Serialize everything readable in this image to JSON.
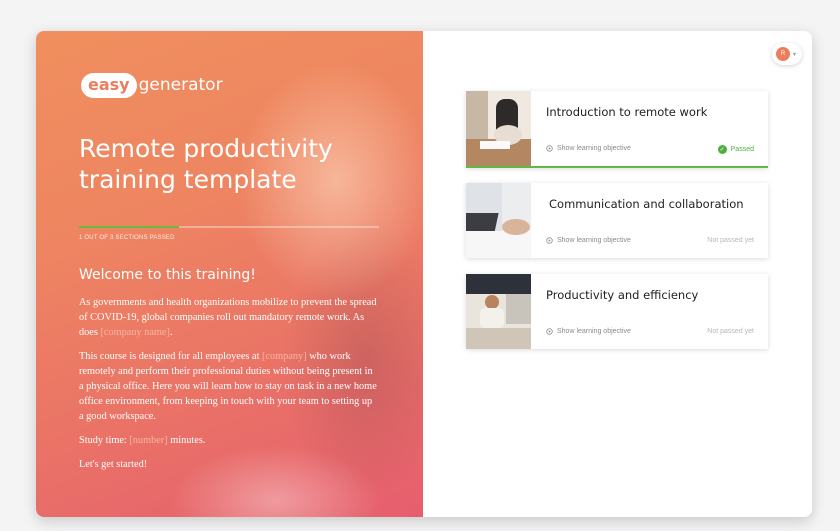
{
  "brand": {
    "logo_highlight": "easy",
    "logo_rest": "generator"
  },
  "course": {
    "title": "Remote productivity training template",
    "progress_label": "1 OUT OF 3 SECTIONS PASSED",
    "progress_fraction": 0.333
  },
  "welcome": {
    "heading": "Welcome to this training!",
    "p1_text": "As governments and health organizations mobilize to prevent the spread of COVID-19, global companies roll out mandatory remote work. As does ",
    "p1_placeholder": "[company name]",
    "p1_end": ".",
    "p2_start": "This course is designed for all employees at ",
    "p2_placeholder": "[company]",
    "p2_text": " who work remotely and perform their professional duties without being present in a physical office. Here you will learn how to stay on task in a new home office environment, from keeping in touch with your team to setting up a good workspace.",
    "study_label": "Study time: ",
    "study_placeholder": "[number]",
    "study_unit": " minutes.",
    "closing": "Let's get started!"
  },
  "user": {
    "initial": "R"
  },
  "sections": [
    {
      "title": "Introduction to remote work",
      "objective_label": "Show learning objective",
      "status": "Passed",
      "passed": true
    },
    {
      "title": "Communication and collaboration",
      "objective_label": "Show learning objective",
      "status": "Not passed yet",
      "passed": false
    },
    {
      "title": "Productivity and efficiency",
      "objective_label": "Show learning objective",
      "status": "Not passed yet",
      "passed": false
    }
  ],
  "colors": {
    "accent": "#ec7e5e",
    "success": "#4fae3a",
    "progress": "#66bb3f"
  }
}
